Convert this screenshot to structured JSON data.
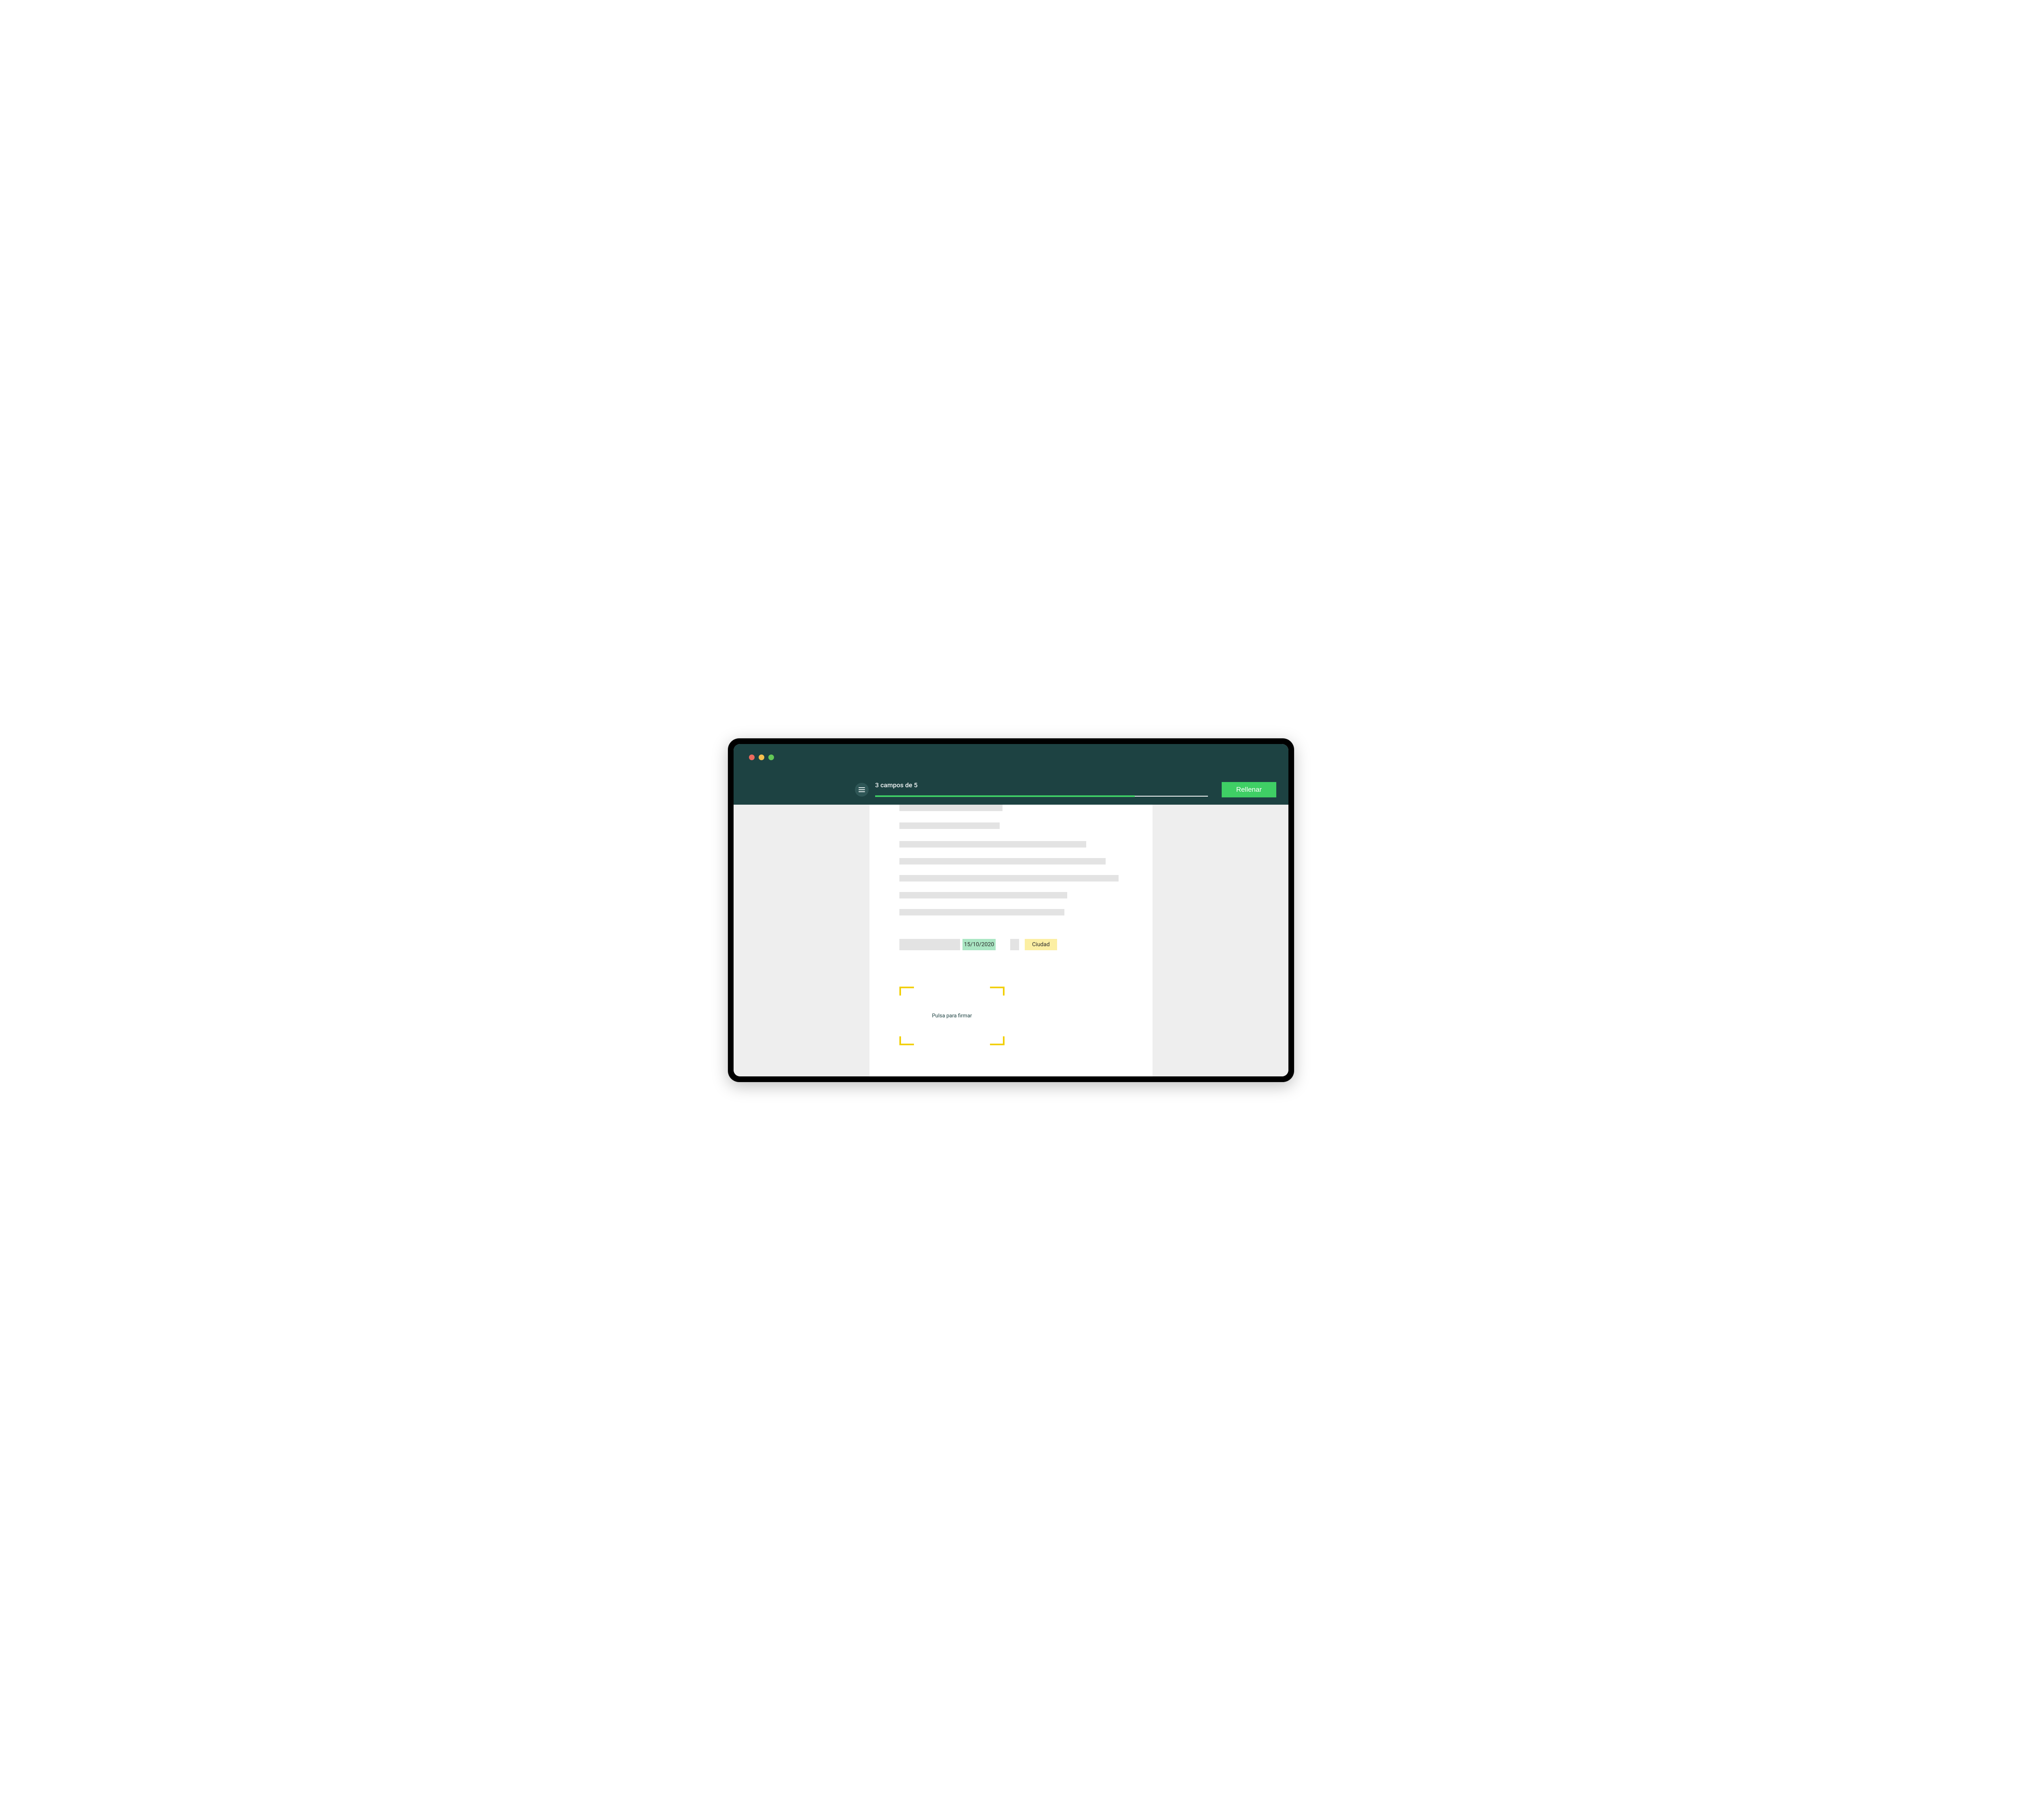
{
  "header": {
    "progress_label": "3 campos de 5",
    "progress_percent": 78,
    "fill_button": "Rellenar"
  },
  "fields": {
    "date_value": "15/10/2020",
    "city_placeholder": "Ciudad"
  },
  "signature": {
    "prompt": "Pulsa para firmar"
  },
  "colors": {
    "header_bg": "#1d4242",
    "accent_green": "#3fcf65",
    "field_filled_bg": "#aae6c3",
    "field_pending_bg": "#fcefa3",
    "signature_corner": "#f2cf00"
  }
}
